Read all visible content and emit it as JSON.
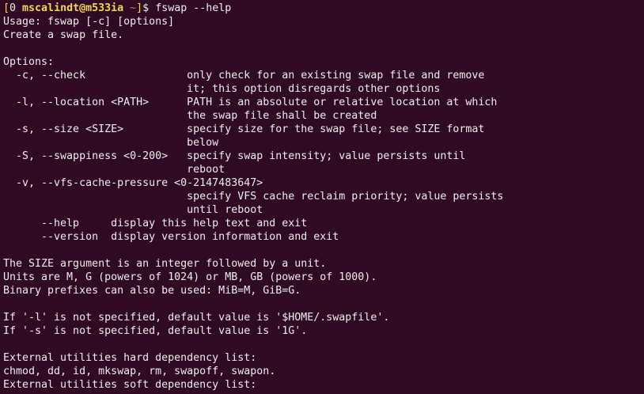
{
  "prompt": {
    "open_bracket": "[",
    "status": "0",
    "user_host": " mscalindt@m533ia ",
    "cwd": "~",
    "close_bracket": "]",
    "symbol": "$ ",
    "command": "fswap --help"
  },
  "output_lines": [
    "Usage: fswap [-c] [options]",
    "Create a swap file.",
    "",
    "Options:",
    "  -c, --check                only check for an existing swap file and remove",
    "                             it; this option disregards other options",
    "  -l, --location <PATH>      PATH is an absolute or relative location at which",
    "                             the swap file shall be created",
    "  -s, --size <SIZE>          specify size for the swap file; see SIZE format",
    "                             below",
    "  -S, --swappiness <0-200>   specify swap intensity; value persists until",
    "                             reboot",
    "  -v, --vfs-cache-pressure <0-2147483647>",
    "                             specify VFS cache reclaim priority; value persists",
    "                             until reboot",
    "      --help     display this help text and exit",
    "      --version  display version information and exit",
    "",
    "The SIZE argument is an integer followed by a unit.",
    "Units are M, G (powers of 1024) or MB, GB (powers of 1000).",
    "Binary prefixes can also be used: MiB=M, GiB=G.",
    "",
    "If '-l' is not specified, default value is '$HOME/.swapfile'.",
    "If '-s' is not specified, default value is '1G'.",
    "",
    "External utilities hard dependency list:",
    "chmod, dd, id, mkswap, rm, swapoff, swapon.",
    "External utilities soft dependency list:"
  ],
  "colors": {
    "background": "#300a24",
    "foreground": "#eeeeec",
    "user_host": "#f5d64e",
    "cwd": "#ef6b5a"
  }
}
